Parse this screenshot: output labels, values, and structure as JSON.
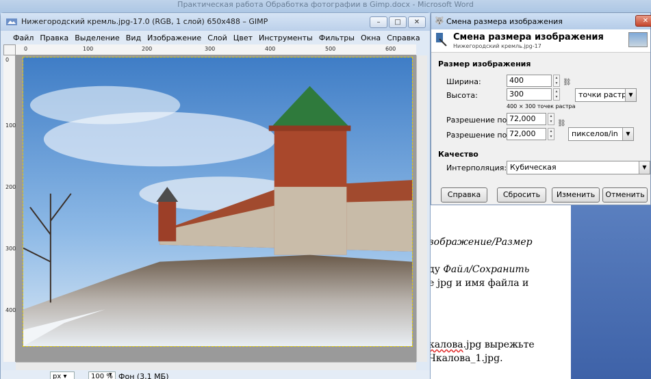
{
  "word": {
    "title": "Практическая работа Обработка фотографии в Gimp.docx - Microsoft Word",
    "lines": [
      {
        "pre": "",
        "ital": "зображение/Размер",
        "post": ""
      },
      {
        "pre": "ду ",
        "ital": "Файл/Сохранить",
        "post": ""
      },
      {
        "pre": "е jpg и имя файла и",
        "ital": "",
        "post": ""
      },
      {
        "pre": "",
        "ital": "",
        "post": "калова.jpg вырежьте",
        "squig": "калова"
      },
      {
        "pre": "Чкалова_1.jpg.",
        "ital": "",
        "post": ""
      }
    ]
  },
  "gimp": {
    "title": "Нижегородский кремль.jpg-17.0 (RGB, 1 слой) 650x488 – GIMP",
    "menu": [
      "Файл",
      "Правка",
      "Выделение",
      "Вид",
      "Изображение",
      "Слой",
      "Цвет",
      "Инструменты",
      "Фильтры",
      "Окна",
      "Справка"
    ],
    "ruler_top": [
      "0",
      "100",
      "200",
      "300",
      "400",
      "500",
      "600"
    ],
    "ruler_left": [
      "0",
      "100",
      "200",
      "300",
      "400"
    ],
    "status": {
      "unit": "px",
      "zoom": "100 %",
      "layer": "Фон (3,1 МБ)"
    },
    "window_buttons": {
      "min": "–",
      "max": "□",
      "close": "✕"
    }
  },
  "dialog": {
    "window_title": "Смена размера изображения",
    "header_title": "Смена размера изображения",
    "header_sub": "Нижегородский кремль.jpg-17",
    "section_size": "Размер изображения",
    "width_label": "Ширина:",
    "width_value": "400",
    "height_label": "Высота:",
    "height_value": "300",
    "size_note": "400 × 300 точек растра",
    "size_unit": "точки растра",
    "xres_label": "Разрешение по X:",
    "xres_value": "72,000",
    "yres_label": "Разрешение по Y:",
    "yres_value": "72,000",
    "res_unit": "пикселов/in",
    "section_quality": "Качество",
    "interp_label": "Интерполяция:",
    "interp_value": "Кубическая",
    "btn_help": "Справка",
    "btn_reset": "Сбросить",
    "btn_resize": "Изменить",
    "btn_cancel": "Отменить"
  }
}
